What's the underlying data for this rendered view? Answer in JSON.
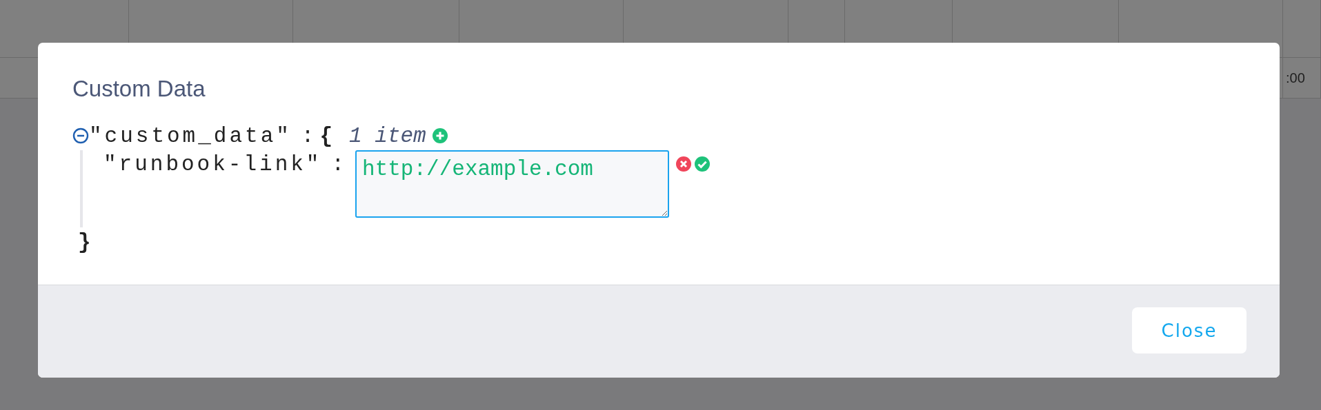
{
  "background_table": {
    "cell_text": ":00"
  },
  "modal": {
    "title": "Custom Data",
    "editor": {
      "expanded": true,
      "key": "\"custom_data\"",
      "separator": ":",
      "open_brace": "{",
      "summary": "1 item",
      "close_brace": "}",
      "entries": [
        {
          "key": "\"runbook-link\"",
          "separator": ":",
          "value": "http://example.com",
          "editing": true
        }
      ]
    },
    "buttons": [
      {
        "label": "Close"
      }
    ]
  }
}
